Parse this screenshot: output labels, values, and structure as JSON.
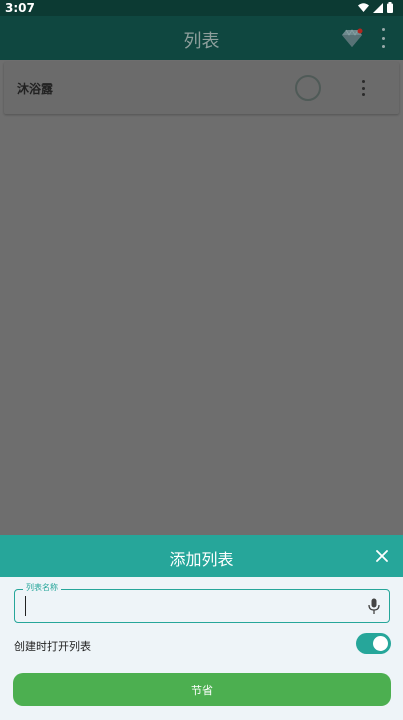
{
  "status_bar": {
    "time": "3:07"
  },
  "toolbar": {
    "title": "列表"
  },
  "lists": [
    {
      "name": "沐浴露"
    }
  ],
  "sheet": {
    "title": "添加列表",
    "field_label": "列表名称",
    "field_value": "",
    "toggle_label": "创建时打开列表",
    "toggle_on": true,
    "save_label": "节省"
  },
  "colors": {
    "accent": "#26a69a",
    "save_button": "#4caf50",
    "toolbar": "#0f4740"
  },
  "icons": [
    "wifi-icon",
    "signal-icon",
    "battery-icon",
    "gem-icon",
    "more-vert-icon",
    "close-icon",
    "mic-icon"
  ]
}
